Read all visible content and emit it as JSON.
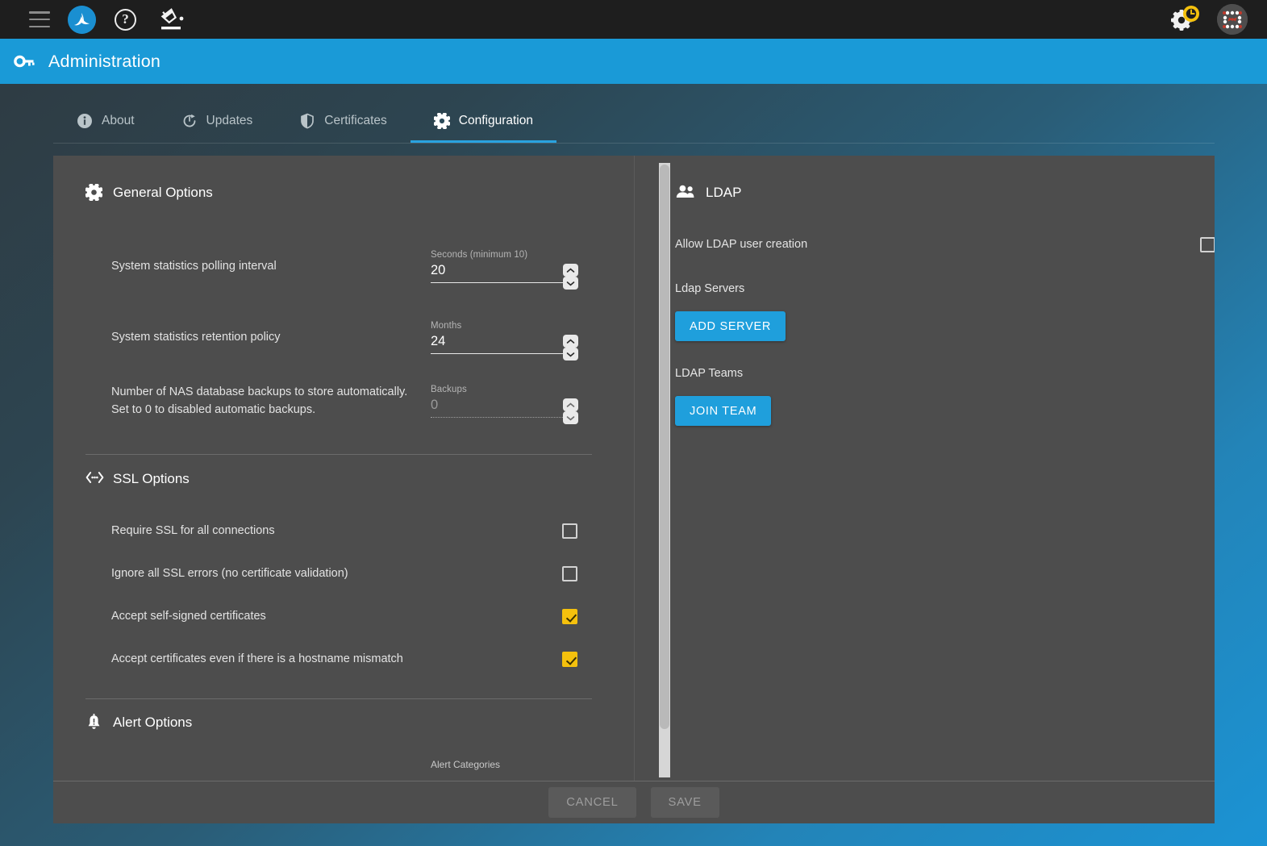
{
  "topbar": {
    "menu_icon": "hamburger-menu-icon",
    "logo_icon": "app-logo-icon",
    "help_icon": "help-circle-icon",
    "theme_icon": "paint-bucket-icon",
    "settings_icon": "gear-icon",
    "settings_badge_icon": "clock-badge-icon",
    "avatar_icon": "user-avatar-identicon"
  },
  "titlebar": {
    "icon": "key-icon",
    "title": "Administration"
  },
  "tabs": [
    {
      "label": "About",
      "icon": "info-icon",
      "active": false
    },
    {
      "label": "Updates",
      "icon": "refresh-icon",
      "active": false
    },
    {
      "label": "Certificates",
      "icon": "shield-icon",
      "active": false
    },
    {
      "label": "Configuration",
      "icon": "gear-icon",
      "active": true
    }
  ],
  "general": {
    "heading": "General Options",
    "icon": "gear-icon",
    "fields": [
      {
        "label": "System statistics polling interval",
        "field_label": "Seconds (minimum 10)",
        "value": "20",
        "disabled": false
      },
      {
        "label": "System statistics retention policy",
        "field_label": "Months",
        "value": "24",
        "disabled": false
      },
      {
        "label": "Number of NAS database backups to store automatically. Set to 0 to disabled automatic backups.",
        "field_label": "Backups",
        "value": "0",
        "disabled": true
      }
    ]
  },
  "ssl": {
    "heading": "SSL Options",
    "icon": "code-brackets-icon",
    "options": [
      {
        "label": "Require SSL for all connections",
        "checked": false
      },
      {
        "label": "Ignore all SSL errors (no certificate validation)",
        "checked": false
      },
      {
        "label": "Accept self-signed certificates",
        "checked": true
      },
      {
        "label": "Accept certificates even if there is a hostname mismatch",
        "checked": true
      }
    ]
  },
  "alert": {
    "heading": "Alert Options",
    "icon": "bell-icon",
    "categories_label": "Alert Categories"
  },
  "ldap": {
    "heading": "LDAP",
    "icon": "people-icon",
    "allow_user_creation_label": "Allow LDAP user creation",
    "allow_user_creation_checked": false,
    "servers_label": "Ldap Servers",
    "add_server_button": "ADD SERVER",
    "teams_label": "LDAP Teams",
    "join_team_button": "JOIN TEAM"
  },
  "footer": {
    "cancel_label": "CANCEL",
    "save_label": "SAVE"
  },
  "colors": {
    "accent_blue": "#1a9ad7",
    "checkbox_yellow": "#f5c10d",
    "card_bg": "#4d4d4d",
    "topbar_bg": "#1e1e1e"
  }
}
